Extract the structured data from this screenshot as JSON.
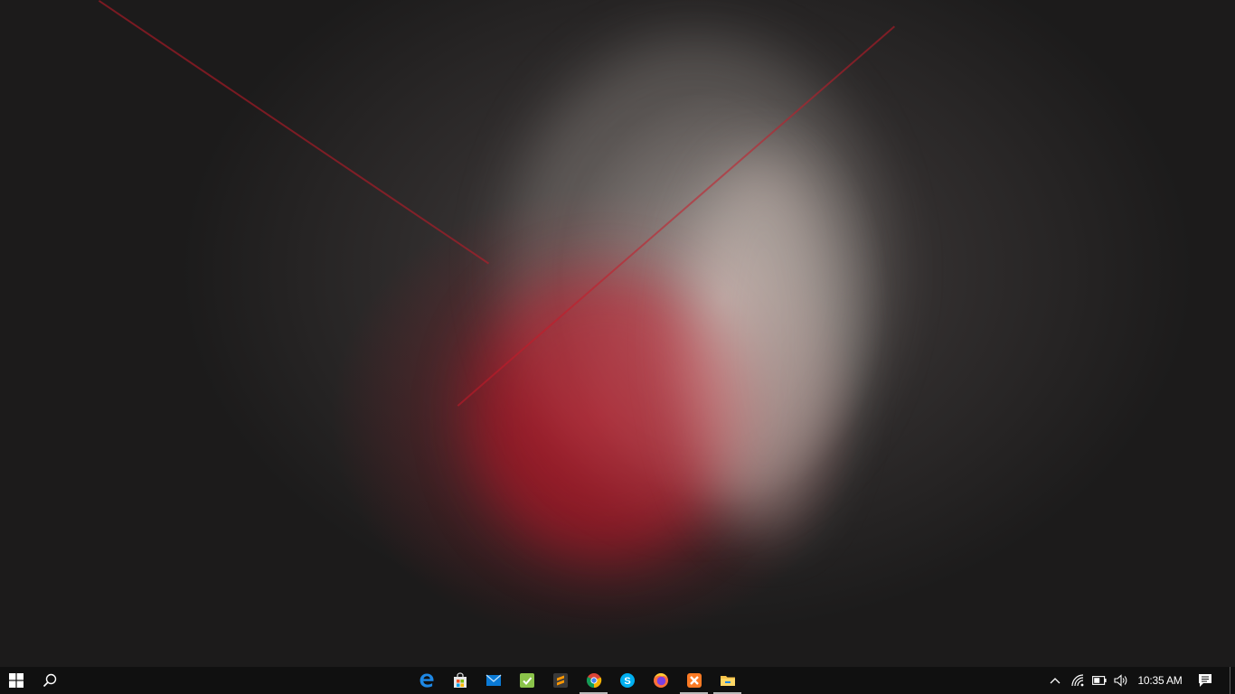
{
  "wallpaper": {
    "description_icon": "wallpaper-image",
    "colors": {
      "accent_red": "#c8102e",
      "dark": "#1c1b1b"
    }
  },
  "taskbar": {
    "start_icon": "windows-logo-icon",
    "search_icon": "search-icon",
    "pinned_apps": [
      {
        "name": "edge-icon",
        "open": false
      },
      {
        "name": "store-icon",
        "open": false
      },
      {
        "name": "mail-icon",
        "open": false
      },
      {
        "name": "checklist-icon",
        "open": false
      },
      {
        "name": "sublime-text-icon",
        "open": false
      },
      {
        "name": "chrome-icon",
        "open": true
      },
      {
        "name": "skype-icon",
        "open": false
      },
      {
        "name": "firefox-icon",
        "open": false
      },
      {
        "name": "xampp-icon",
        "open": true
      },
      {
        "name": "file-explorer-icon",
        "open": true
      }
    ],
    "tray": {
      "chevron_icon": "chevron-up-icon",
      "network_icon": "wifi-icon",
      "battery_icon": "battery-icon",
      "volume_icon": "volume-icon",
      "clock": "10:35 AM",
      "notification_icon": "action-center-icon"
    }
  }
}
